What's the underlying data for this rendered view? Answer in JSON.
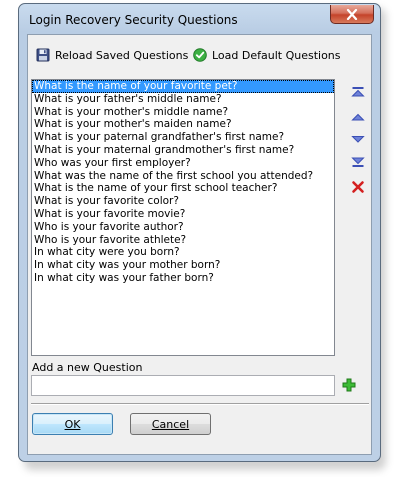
{
  "window": {
    "title": "Login Recovery Security Questions"
  },
  "toolbar": {
    "reload_label": "Reload Saved Questions",
    "load_default_label": "Load Default Questions"
  },
  "questions": [
    "What is the name of your favorite pet?",
    "What is your father's middle name?",
    "What is your mother's middle name?",
    "What is your mother's maiden name?",
    "What is your paternal grandfather's first name?",
    "What is your maternal grandmother's first name?",
    "Who was your first employer?",
    "What was the name of the first school you attended?",
    "What is the name of your first school teacher?",
    "What is your favorite color?",
    "What is your favorite movie?",
    "Who is your favorite author?",
    "Who is your favorite athlete?",
    "In what city were you born?",
    "In what city was your mother born?",
    "In what city was your father born?"
  ],
  "selected_index": 0,
  "side_buttons": {
    "move_top_icon": "move-to-top-icon",
    "move_up_icon": "move-up-icon",
    "move_down_icon": "move-down-icon",
    "move_bottom_icon": "move-to-bottom-icon",
    "delete_icon": "delete-icon"
  },
  "add_question": {
    "label": "Add a new Question",
    "value": "",
    "add_icon": "plus-icon"
  },
  "buttons": {
    "ok_label": "OK",
    "cancel_label": "Cancel"
  },
  "colors": {
    "selection": "#3399ff",
    "arrow_blue": "#3b4fb5",
    "delete_red": "#d42020",
    "add_green": "#2fa52b",
    "default_check_green": "#2e9e2e"
  }
}
